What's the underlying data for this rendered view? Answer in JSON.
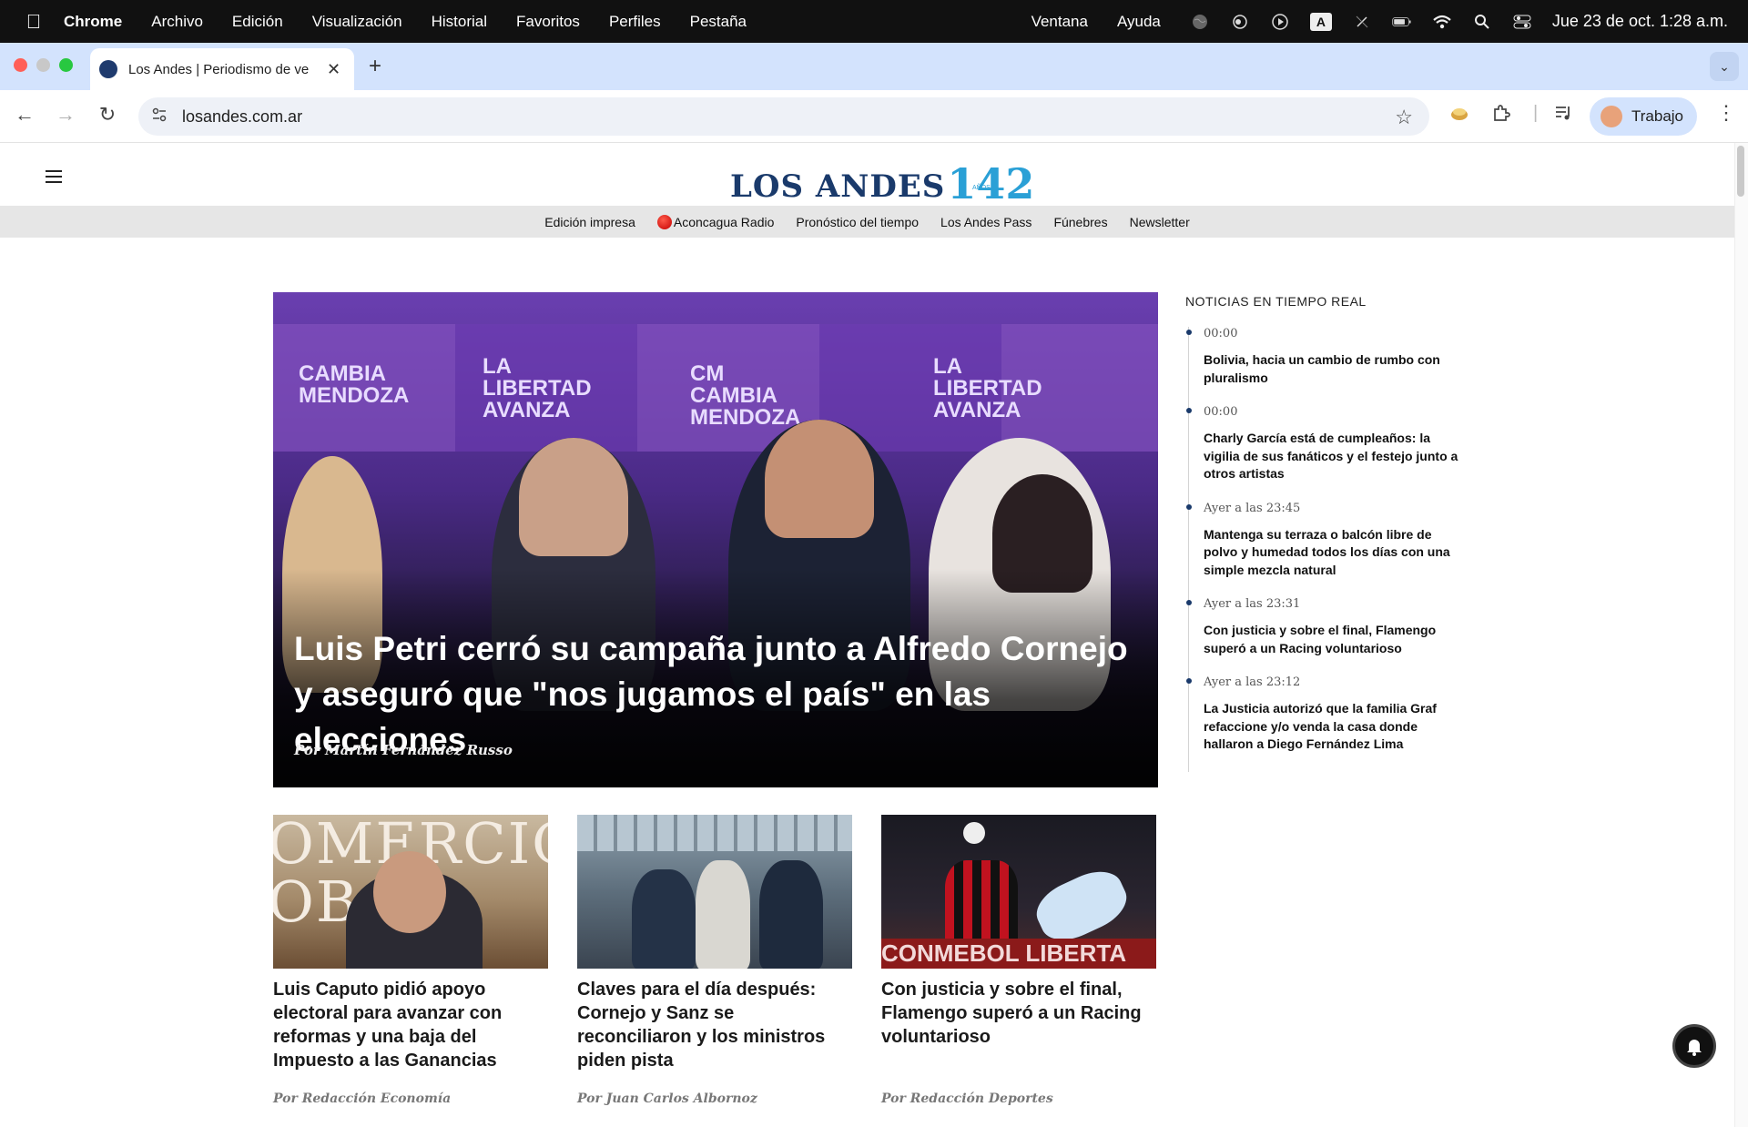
{
  "menubar": {
    "app": "Chrome",
    "items": [
      "Archivo",
      "Edición",
      "Visualización",
      "Historial",
      "Favoritos",
      "Perfiles",
      "Pestaña"
    ],
    "right_items": [
      "Ventana",
      "Ayuda"
    ],
    "status_icons": [
      "globe-icon",
      "screen-record-icon",
      "play-circle-icon",
      "input-source-icon",
      "pen-slash-icon",
      "battery-icon",
      "wifi-icon",
      "spotlight-icon",
      "control-center-icon"
    ],
    "input_source_label": "A",
    "clock": "Jue 23 de oct.  1:28 a.m."
  },
  "browser": {
    "tab_title": "Los Andes | Periodismo de ve",
    "url": "losandes.com.ar",
    "profile_label": "Trabajo",
    "colors": {
      "tabstrip": "#d3e3fd",
      "omnibox": "#eef1f7"
    }
  },
  "site": {
    "logo_text": "LOS ANDES",
    "logo_number": "142",
    "logo_small": "AÑOS",
    "subnav": [
      "Edición impresa",
      "Aconcagua Radio",
      "Pronóstico del tiempo",
      "Los Andes Pass",
      "Fúnebres",
      "Newsletter"
    ],
    "colors": {
      "brand_blue": "#1a3a6b",
      "brand_cyan": "#2aa0d6",
      "subnav_bg": "#e6e6e6"
    }
  },
  "hero": {
    "headline": "Luis Petri cerró su campaña junto a Alfredo Cornejo y aseguró que \"nos jugamos el país\" en las elecciones",
    "byline": "Por Martín Fernández Russo",
    "photo_texts": [
      "CAMBIA MENDOZA",
      "LA LIBERTAD AVANZA",
      "CM CAMBIA MENDOZA",
      "LA LIBERTAD AVANZA"
    ]
  },
  "sidebar": {
    "title": "NOTICIAS EN TIEMPO REAL",
    "items": [
      {
        "time": "00:00",
        "headline": "Bolivia, hacia un cambio de rumbo con pluralismo"
      },
      {
        "time": "00:00",
        "headline": "Charly García está de cumpleaños: la vigilia de sus fanáticos y el festejo junto a otros artistas"
      },
      {
        "time": "Ayer a las 23:45",
        "headline": "Mantenga su terraza o balcón libre de polvo y humedad todos los días con una simple mezcla natural"
      },
      {
        "time": "Ayer a las 23:31",
        "headline": "Con justicia y sobre el final, Flamengo superó a un Racing voluntarioso"
      },
      {
        "time": "Ayer a las 23:12",
        "headline": "La Justicia autorizó que la familia Graf refaccione y/o venda la casa donde hallaron a Diego Fernández Lima"
      }
    ]
  },
  "cards": [
    {
      "title": "Luis Caputo pidió apoyo electoral para avanzar con reformas y una baja del Impuesto a las Ganancias",
      "byline": "Por Redacción Economía",
      "photo_text": "OMERCIO OBA"
    },
    {
      "title": "Claves para el día después: Cornejo y Sanz se reconciliaron y los ministros piden pista",
      "byline": "Por Juan Carlos Albornoz"
    },
    {
      "title": "Con justicia y sobre el final, Flamengo superó a un Racing voluntarioso",
      "byline": "Por Redacción Deportes",
      "photo_text": "CONMEBOL LIBERTA"
    }
  ]
}
